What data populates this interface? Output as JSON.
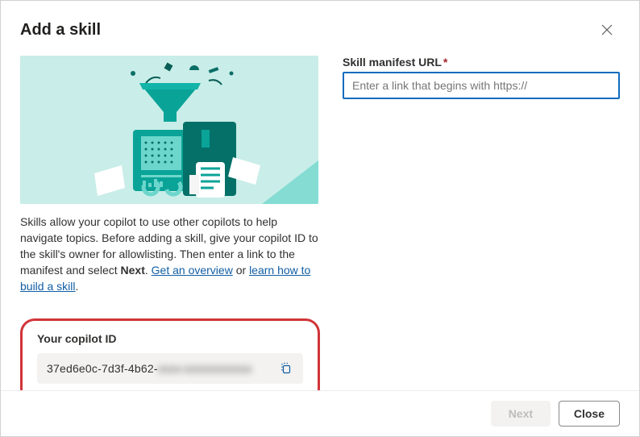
{
  "dialog": {
    "title": "Add a skill"
  },
  "description": {
    "line1": "Skills allow your copilot to use other copilots to help navigate topics. Before adding a skill, give your copilot ID to the skill's owner for allowlisting. Then enter a link to the manifest and select ",
    "bold_word": "Next",
    "after_bold": ". ",
    "link_overview": "Get an overview",
    "or_text": " or ",
    "link_learn": "learn how to build a skill",
    "tail": "."
  },
  "copilot_id": {
    "label": "Your copilot ID",
    "visible_prefix": "37ed6e0c-7d3f-4b62-",
    "obscured_tail": "xxxx-xxxxxxxxxxxx"
  },
  "form": {
    "manifest_label": "Skill manifest URL",
    "required_marker": "*",
    "manifest_placeholder": "Enter a link that begins with https://",
    "manifest_value": ""
  },
  "footer": {
    "next_label": "Next",
    "close_label": "Close"
  }
}
